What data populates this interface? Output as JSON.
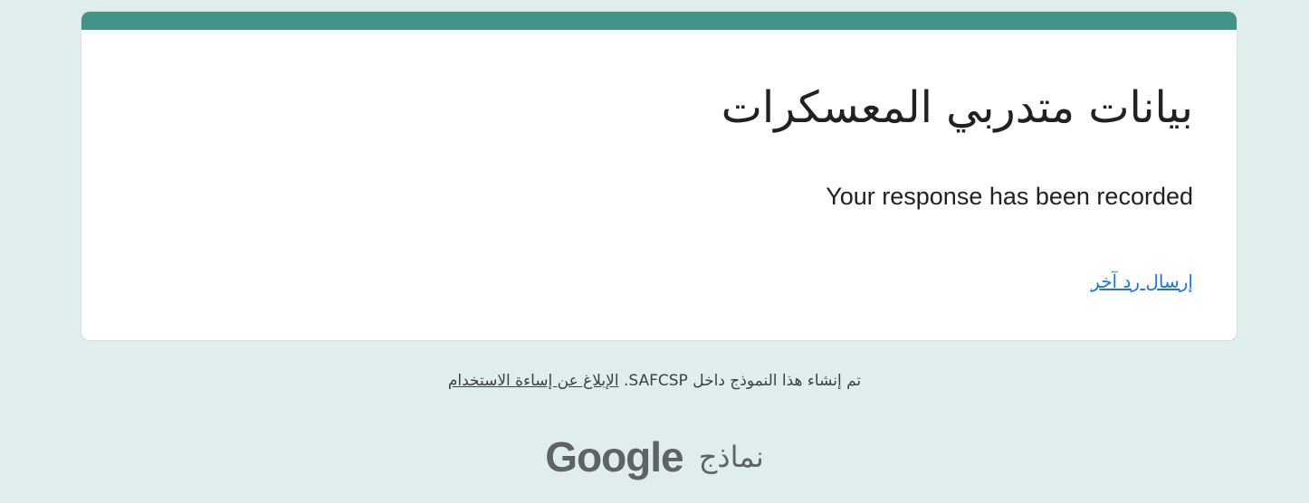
{
  "form": {
    "title": "بيانات متدربي المعسكرات",
    "confirmation": "Your response has been recorded",
    "submit_another_label": "إرسال رد آخر"
  },
  "footer": {
    "created_text": "تم إنشاء هذا النموذج داخل SAFCSP.",
    "report_abuse_label": "الإبلاغ عن إساءة الاستخدام"
  },
  "branding": {
    "google_label": "Google",
    "forms_label": "نماذج"
  },
  "colors": {
    "page_background": "#dfeeec",
    "accent": "#439488",
    "link": "#1a73e8",
    "text": "#202124"
  }
}
